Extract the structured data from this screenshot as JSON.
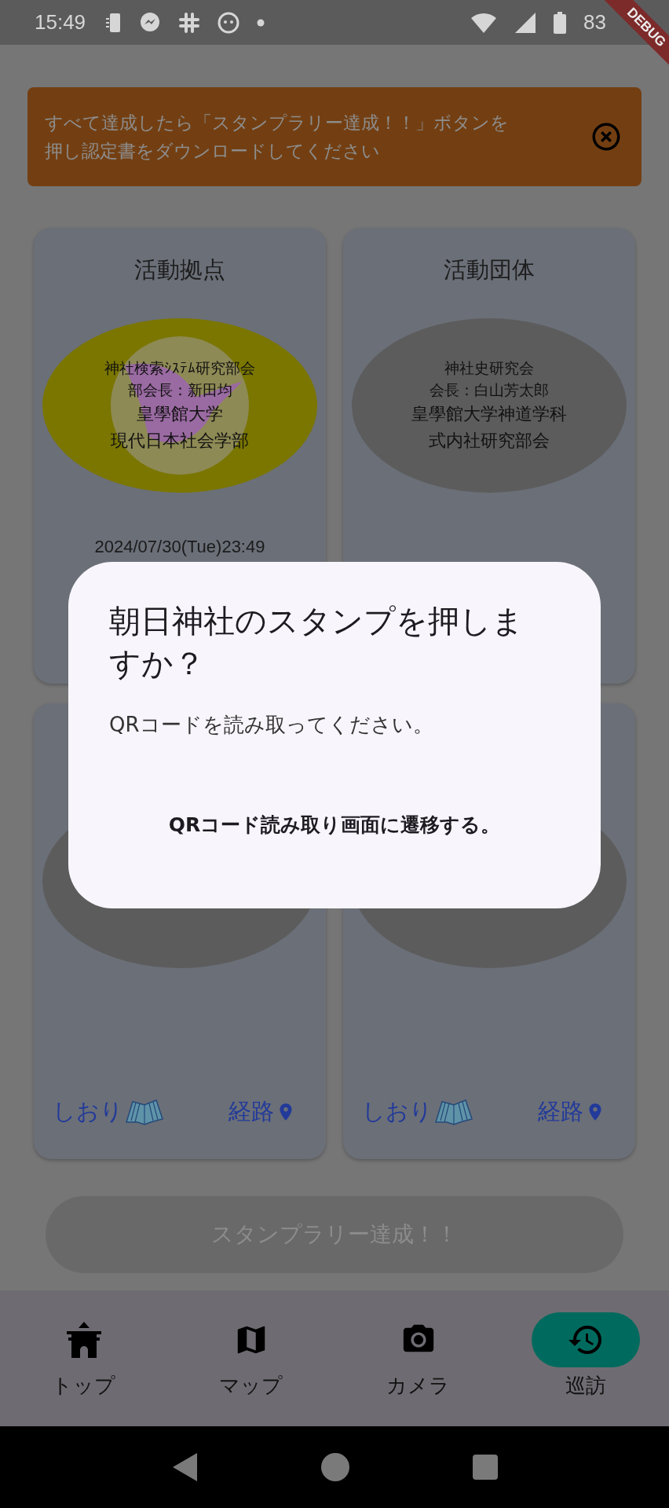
{
  "status_bar": {
    "time": "15:49",
    "battery": "83"
  },
  "debug_ribbon": {
    "label": "DEBUG"
  },
  "notice": {
    "text": "すべて達成したら「スタンプラリー達成！！」ボタンを押し認定書をダウンロードしてください"
  },
  "cards": [
    {
      "title": "活動拠点",
      "emblem": {
        "kind": "stamped",
        "org_lines": [
          "神社検索ｼｽﾃﾑ研究部会",
          "部会長：新田均"
        ],
        "affiliation_lines": [
          "皇學館大学",
          "現代日本社会学部"
        ]
      },
      "date": "2024/07/30(Tue)23:49"
    },
    {
      "title": "活動団体",
      "emblem": {
        "kind": "plain",
        "org_lines": [
          "神社史研究会",
          "会長：白山芳太郎"
        ],
        "affiliation_lines": [
          "皇學館大学神道学科",
          "式内社研究部会"
        ]
      }
    },
    {
      "emblem": {
        "kind": "plain"
      },
      "links": [
        {
          "label": "しおり",
          "kind": "book"
        },
        {
          "label": "経路",
          "kind": "pin"
        }
      ]
    },
    {
      "emblem": {
        "kind": "plain"
      },
      "links": [
        {
          "label": "しおり",
          "kind": "book"
        },
        {
          "label": "経路",
          "kind": "pin"
        }
      ]
    }
  ],
  "complete_button": {
    "label": "スタンプラリー達成！！",
    "disabled": true
  },
  "nav": [
    {
      "label": "トップ",
      "selected": false
    },
    {
      "label": "マップ",
      "selected": false
    },
    {
      "label": "カメラ",
      "selected": false
    },
    {
      "label": "巡訪",
      "selected": true
    }
  ],
  "dialog": {
    "title": "朝日神社のスタンプを押しますか？",
    "message": "QRコードを読み取ってください。",
    "action": "QRコード読み取り画面に遷移する。"
  }
}
